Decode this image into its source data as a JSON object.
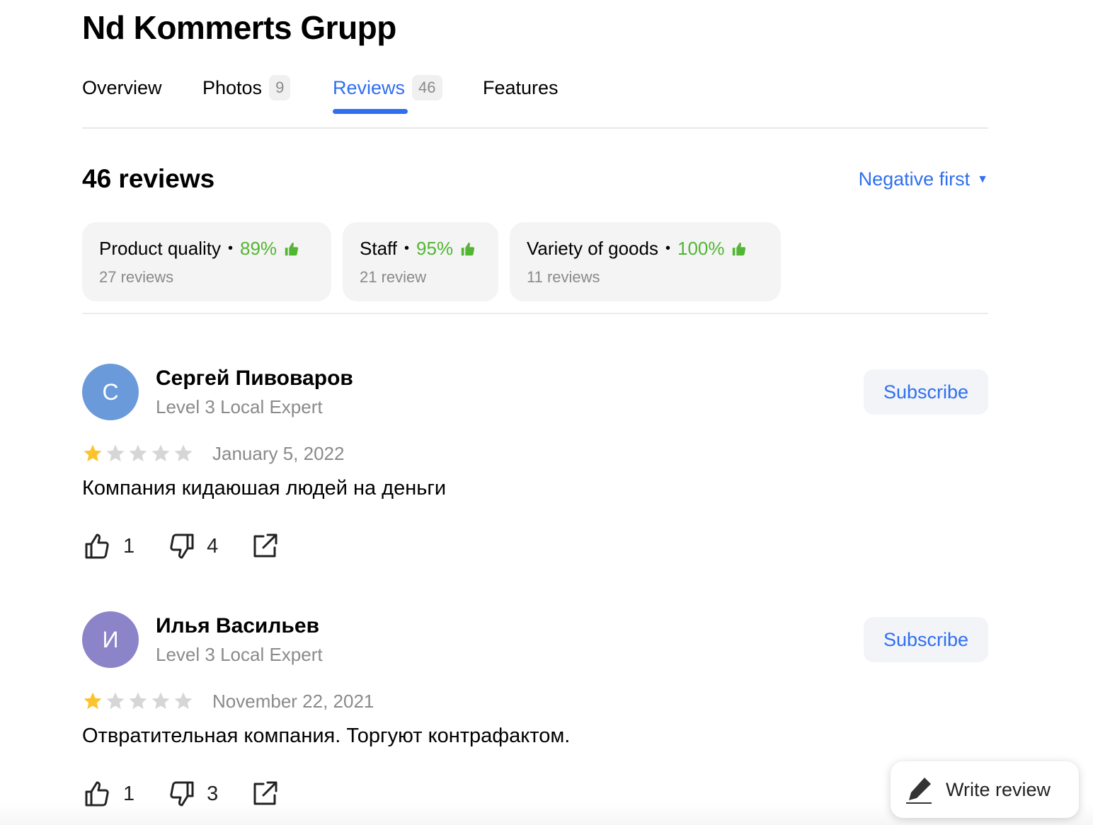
{
  "org": {
    "title": "Nd Kommerts Grupp"
  },
  "tabs": [
    {
      "label": "Overview",
      "badge": null
    },
    {
      "label": "Photos",
      "badge": "9"
    },
    {
      "label": "Reviews",
      "badge": "46"
    },
    {
      "label": "Features",
      "badge": null
    }
  ],
  "reviews_header": {
    "count_label": "46 reviews",
    "sort_label": "Negative first"
  },
  "aspects": [
    {
      "name": "Product quality",
      "percent": "89%",
      "count": "27 reviews"
    },
    {
      "name": "Staff",
      "percent": "95%",
      "count": "21 review"
    },
    {
      "name": "Variety of goods",
      "percent": "100%",
      "count": "11 reviews"
    }
  ],
  "reviews": [
    {
      "initial": "С",
      "avatar_color": "#6a9ad9",
      "author": "Сергей Пивоваров",
      "level": "Level 3 Local Expert",
      "subscribe_label": "Subscribe",
      "rating": 1,
      "date": "January 5, 2022",
      "text": "Компания кидаюшая людей на деньги",
      "likes": "1",
      "dislikes": "4"
    },
    {
      "initial": "И",
      "avatar_color": "#8c84c8",
      "author": "Илья Васильев",
      "level": "Level 3 Local Expert",
      "subscribe_label": "Subscribe",
      "rating": 1,
      "date": "November 22, 2021",
      "text": "Отвратительная компания. Торгуют контрафактом.",
      "likes": "1",
      "dislikes": "3"
    }
  ],
  "write_review": {
    "label": "Write review"
  },
  "colors": {
    "accent": "#2f6ff0",
    "positive": "#52b633",
    "star_filled": "#fcc32c",
    "star_empty": "#d6d6d6"
  },
  "icons": [
    "thumb-up-icon",
    "thumb-down-icon",
    "share-icon",
    "pencil-icon",
    "star-icon",
    "caret-down-icon"
  ]
}
